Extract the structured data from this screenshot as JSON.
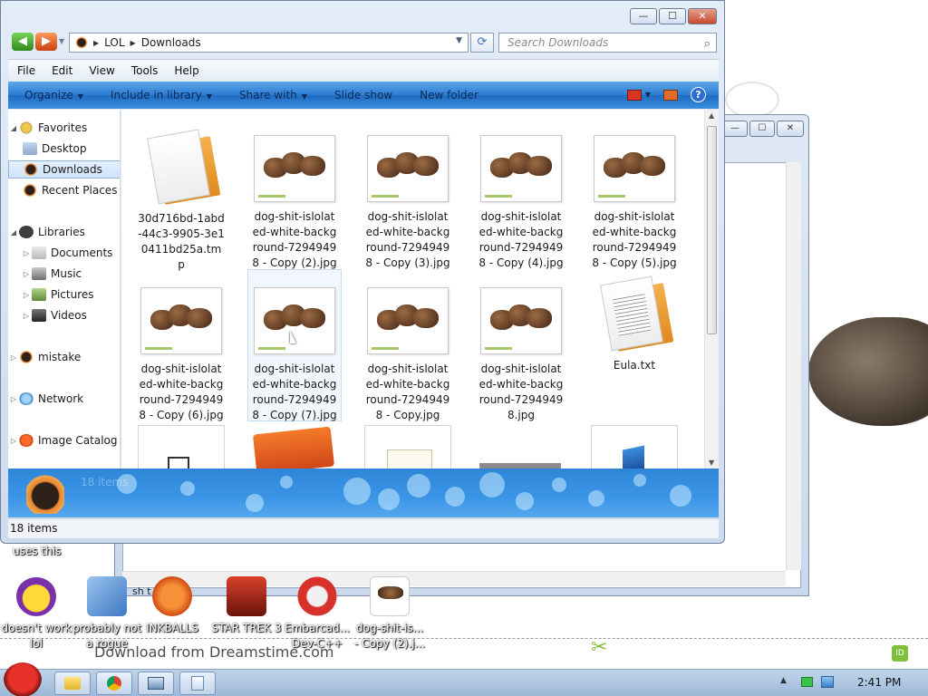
{
  "window": {
    "title_buttons": {
      "minimize": "—",
      "maximize": "☐",
      "close": "✕"
    },
    "breadcrumb": [
      "LOL",
      "Downloads"
    ],
    "search": {
      "placeholder": "Search Downloads"
    },
    "menu": [
      "File",
      "Edit",
      "View",
      "Tools",
      "Help"
    ],
    "commands": [
      {
        "label": "Organize",
        "dropdown": true
      },
      {
        "label": "Include in library",
        "dropdown": true
      },
      {
        "label": "Share with",
        "dropdown": true
      },
      {
        "label": "Slide show",
        "dropdown": false
      },
      {
        "label": "New folder",
        "dropdown": false
      }
    ],
    "help_label": "?"
  },
  "nav_pane": {
    "favorites_label": "Favorites",
    "favorites": [
      "Desktop",
      "Downloads",
      "Recent Places"
    ],
    "libraries_label": "Libraries",
    "libraries": [
      "Documents",
      "Music",
      "Pictures",
      "Videos"
    ],
    "other": [
      "mistake",
      "Network",
      "Image Catalog"
    ]
  },
  "files": [
    {
      "name": "30d716bd-1abd-44c3-9905-3e10411bd25a.tmp",
      "kind": "document"
    },
    {
      "name": "dog-shit-islolated-white-background-72949498 - Copy (2).jpg",
      "kind": "photo"
    },
    {
      "name": "dog-shit-islolated-white-background-72949498 - Copy (3).jpg",
      "kind": "photo"
    },
    {
      "name": "dog-shit-islolated-white-background-72949498 - Copy (4).jpg",
      "kind": "photo"
    },
    {
      "name": "dog-shit-islolated-white-background-72949498 - Copy (5).jpg",
      "kind": "photo"
    },
    {
      "name": "dog-shit-islolated-white-background-72949498 - Copy (6).jpg",
      "kind": "photo"
    },
    {
      "name": "dog-shit-islolated-white-background-72949498 - Copy (7).jpg",
      "kind": "photo"
    },
    {
      "name": "dog-shit-islolated-white-background-72949498 - Copy.jpg",
      "kind": "photo"
    },
    {
      "name": "dog-shit-islolated-white-background-72949498.jpg",
      "kind": "photo"
    },
    {
      "name": "Eula.txt",
      "kind": "text"
    }
  ],
  "details_pane": {
    "count": "18 items"
  },
  "status_bar": {
    "text": "18 items"
  },
  "back_window": {
    "text": "sh t"
  },
  "desktop": {
    "uses_this": "uses this",
    "icons": [
      {
        "label": "doesn't work lol",
        "color": "#7b2fa8"
      },
      {
        "label": "probably not a rogue",
        "color": "#5b8fd6"
      },
      {
        "label": "INKBALLS",
        "color": "#e2611f"
      },
      {
        "label": "STAR TREK 3",
        "color": "#b3261e"
      },
      {
        "label": "Embarcad... Dev-C++",
        "color": "#d8302a"
      },
      {
        "label": "dog-shit-is... - Copy (2).j...",
        "color": "#8a5a36"
      }
    ],
    "ad_text": "Download from Dreamstime.com",
    "ad_badge": "ID"
  },
  "taskbar": {
    "clock": "2:41 PM"
  }
}
